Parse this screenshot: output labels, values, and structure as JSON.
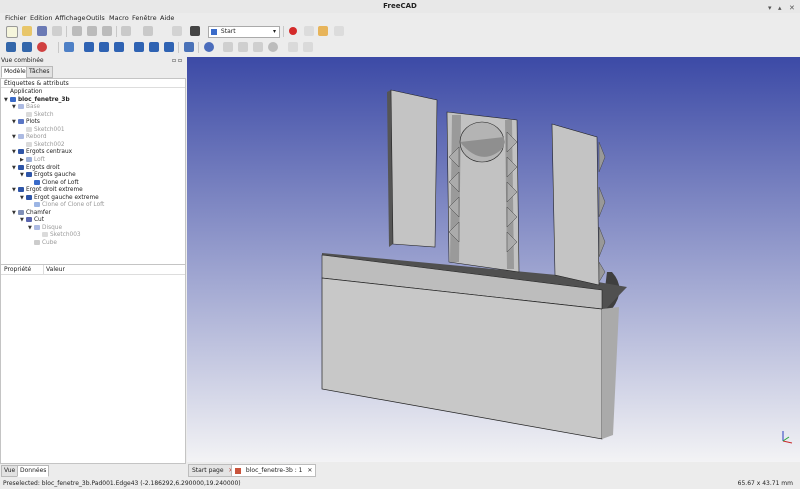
{
  "window": {
    "title": "FreeCAD"
  },
  "menu": [
    "Fichier",
    "Edition",
    "Affichage",
    "Outils",
    "Macro",
    "Fenêtre",
    "Aide"
  ],
  "toolbar": {
    "workbench": "Start"
  },
  "combo": {
    "title": "Vue combinée",
    "tab_model": "Modèle",
    "tab_tasks": "Tâches",
    "labels_header": "Étiquettes & attributs"
  },
  "tree": [
    {
      "label": "Application",
      "depth": 0,
      "arrow": "",
      "icon": "",
      "dim": false
    },
    {
      "label": "bloc_fenetre_3b",
      "depth": 0,
      "arrow": "▼",
      "icon": "document-icon",
      "dim": false,
      "bold": true
    },
    {
      "label": "Base",
      "depth": 1,
      "arrow": "▼",
      "icon": "pad-icon",
      "dim": true
    },
    {
      "label": "Sketch",
      "depth": 2,
      "arrow": "",
      "icon": "sketch-icon",
      "dim": true
    },
    {
      "label": "Plots",
      "depth": 1,
      "arrow": "▼",
      "icon": "pad-icon",
      "dim": false
    },
    {
      "label": "Sketch001",
      "depth": 2,
      "arrow": "",
      "icon": "sketch-icon",
      "dim": true
    },
    {
      "label": "Rebord",
      "depth": 1,
      "arrow": "▼",
      "icon": "pad-icon",
      "dim": true
    },
    {
      "label": "Sketch002",
      "depth": 2,
      "arrow": "",
      "icon": "sketch-icon",
      "dim": true
    },
    {
      "label": "Ergots centraux",
      "depth": 1,
      "arrow": "▼",
      "icon": "array-icon",
      "dim": false
    },
    {
      "label": "Loft",
      "depth": 2,
      "arrow": "▶",
      "icon": "loft-icon",
      "dim": true
    },
    {
      "label": "Ergots droit",
      "depth": 1,
      "arrow": "▼",
      "icon": "array-icon",
      "dim": false
    },
    {
      "label": "Ergots gauche",
      "depth": 2,
      "arrow": "▼",
      "icon": "array-icon",
      "dim": false
    },
    {
      "label": "Clone of Loft",
      "depth": 3,
      "arrow": "",
      "icon": "clone-icon",
      "dim": false
    },
    {
      "label": "Ergot droit extreme",
      "depth": 1,
      "arrow": "▼",
      "icon": "array-icon",
      "dim": false
    },
    {
      "label": "Ergot gauche extreme",
      "depth": 2,
      "arrow": "▼",
      "icon": "array-icon",
      "dim": false
    },
    {
      "label": "Clone of Clone of Loft",
      "depth": 3,
      "arrow": "",
      "icon": "clone-icon",
      "dim": true
    },
    {
      "label": "Chamfer",
      "depth": 1,
      "arrow": "▼",
      "icon": "chamfer-icon",
      "dim": false
    },
    {
      "label": "Cut",
      "depth": 2,
      "arrow": "▼",
      "icon": "cut-icon",
      "dim": false
    },
    {
      "label": "Disque",
      "depth": 3,
      "arrow": "▼",
      "icon": "pad-icon",
      "dim": true
    },
    {
      "label": "Sketch003",
      "depth": 4,
      "arrow": "",
      "icon": "sketch-icon",
      "dim": true
    },
    {
      "label": "Cube",
      "depth": 3,
      "arrow": "",
      "icon": "cube-icon",
      "dim": true
    }
  ],
  "properties": {
    "col_property": "Propriété",
    "col_value": "Valeur"
  },
  "bottom_tabs": {
    "view": "Vue",
    "data": "Données"
  },
  "doc_tabs": [
    {
      "label": "Start page",
      "active": false
    },
    {
      "label": "bloc_fenetre-3b : 1",
      "active": true
    }
  ],
  "status": {
    "preselected": "Preselected: bloc_fenetre_3b.Pad001.Edge43 (-2.186292,6.290000,19.240000)",
    "dimensions": "65.67 x 43.71 mm"
  },
  "colors": {
    "viewport_top": "#3c4aa6",
    "viewport_bottom": "#f3f3f5",
    "model_face": "#c6c6c6",
    "model_dark": "#555555",
    "record": "#d42a2a"
  }
}
